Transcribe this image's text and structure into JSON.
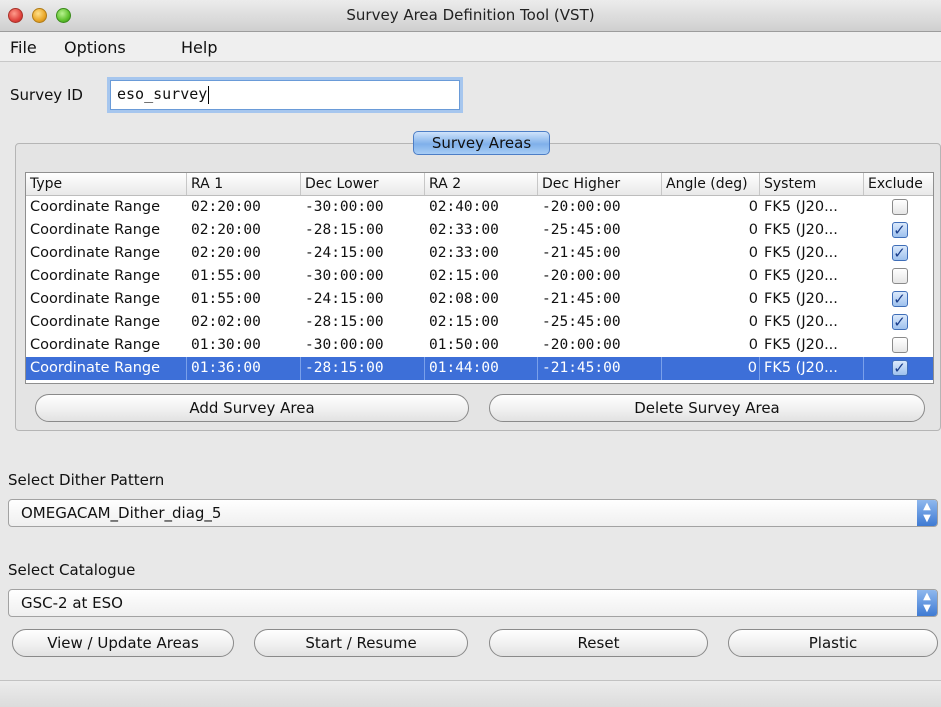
{
  "window": {
    "title": "Survey Area Definition Tool (VST)"
  },
  "menu": [
    "File",
    "Options",
    "Help"
  ],
  "survey_id": {
    "label": "Survey ID",
    "value": "eso_survey"
  },
  "survey_areas": {
    "title": "Survey Areas",
    "columns": [
      "Type",
      "RA 1",
      "Dec Lower",
      "RA 2",
      "Dec Higher",
      "Angle (deg)",
      "System",
      "Exclude"
    ],
    "rows": [
      {
        "type": "Coordinate Range",
        "ra1": "02:20:00",
        "dec_lower": "-30:00:00",
        "ra2": "02:40:00",
        "dec_higher": "-20:00:00",
        "angle": "0",
        "system": "FK5 (J20...",
        "exclude": false
      },
      {
        "type": "Coordinate Range",
        "ra1": "02:20:00",
        "dec_lower": "-28:15:00",
        "ra2": "02:33:00",
        "dec_higher": "-25:45:00",
        "angle": "0",
        "system": "FK5 (J20...",
        "exclude": true
      },
      {
        "type": "Coordinate Range",
        "ra1": "02:20:00",
        "dec_lower": "-24:15:00",
        "ra2": "02:33:00",
        "dec_higher": "-21:45:00",
        "angle": "0",
        "system": "FK5 (J20...",
        "exclude": true
      },
      {
        "type": "Coordinate Range",
        "ra1": "01:55:00",
        "dec_lower": "-30:00:00",
        "ra2": "02:15:00",
        "dec_higher": "-20:00:00",
        "angle": "0",
        "system": "FK5 (J20...",
        "exclude": false
      },
      {
        "type": "Coordinate Range",
        "ra1": "01:55:00",
        "dec_lower": "-24:15:00",
        "ra2": "02:08:00",
        "dec_higher": "-21:45:00",
        "angle": "0",
        "system": "FK5 (J20...",
        "exclude": true
      },
      {
        "type": "Coordinate Range",
        "ra1": "02:02:00",
        "dec_lower": "-28:15:00",
        "ra2": "02:15:00",
        "dec_higher": "-25:45:00",
        "angle": "0",
        "system": "FK5 (J20...",
        "exclude": true
      },
      {
        "type": "Coordinate Range",
        "ra1": "01:30:00",
        "dec_lower": "-30:00:00",
        "ra2": "01:50:00",
        "dec_higher": "-20:00:00",
        "angle": "0",
        "system": "FK5 (J20...",
        "exclude": false
      },
      {
        "type": "Coordinate Range",
        "ra1": "01:36:00",
        "dec_lower": "-28:15:00",
        "ra2": "01:44:00",
        "dec_higher": "-21:45:00",
        "angle": "0",
        "system": "FK5 (J20...",
        "exclude": true,
        "selected": true
      }
    ],
    "add_button": "Add Survey Area",
    "delete_button": "Delete Survey Area"
  },
  "dither": {
    "label": "Select Dither Pattern",
    "value": "OMEGACAM_Dither_diag_5"
  },
  "catalogue": {
    "label": "Select Catalogue",
    "value": "GSC-2 at ESO"
  },
  "actions": {
    "view_update": "View / Update Areas",
    "start_resume": "Start / Resume",
    "reset": "Reset",
    "plastic": "Plastic"
  },
  "colors": {
    "selection": "#3d6fd8",
    "focus": "#a6c6ee"
  }
}
